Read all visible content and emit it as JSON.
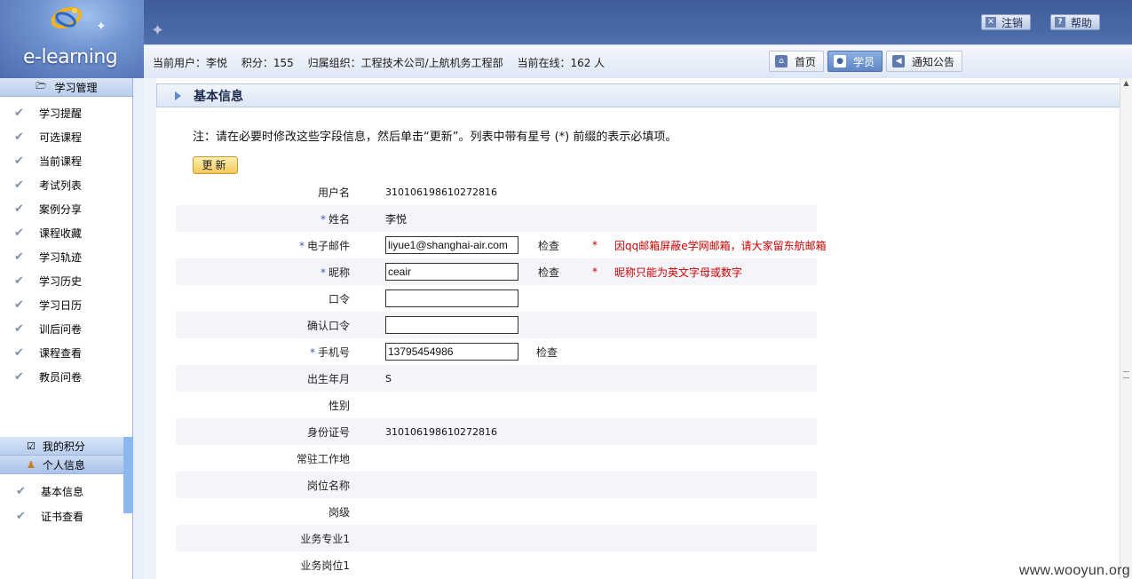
{
  "app": {
    "logo_text": "e-learning"
  },
  "top_links": [
    {
      "icon": "close-icon",
      "label": "注销"
    },
    {
      "icon": "help-icon",
      "label": "帮助"
    }
  ],
  "info_bar": {
    "user": "当前用户：李悦",
    "points": "积分：155",
    "org": "归属组织：工程技术公司/上航机务工程部",
    "online": "当前在线：162 人"
  },
  "nav": [
    {
      "icon": "home-icon",
      "label": "首页",
      "active": false
    },
    {
      "icon": "user-icon",
      "label": "学员",
      "active": true
    },
    {
      "icon": "speaker-icon",
      "label": "通知公告",
      "active": false
    }
  ],
  "sidebar": {
    "section1": "学习管理",
    "items": [
      {
        "label": "学习提醒"
      },
      {
        "label": "可选课程"
      },
      {
        "label": "当前课程"
      },
      {
        "label": "考试列表"
      },
      {
        "label": "案例分享"
      },
      {
        "label": "课程收藏"
      },
      {
        "label": "学习轨迹"
      },
      {
        "label": "学习历史"
      },
      {
        "label": "学习日历"
      },
      {
        "label": "训后问卷"
      },
      {
        "label": "课程查看"
      },
      {
        "label": "教员问卷"
      }
    ],
    "section2": "我的积分",
    "section3": "个人信息",
    "items2": [
      {
        "label": "基本信息"
      },
      {
        "label": "证书查看"
      }
    ]
  },
  "panel": {
    "title": "基本信息",
    "note": "注：请在必要时修改这些字段信息，然后单击“更新”。列表中带有星号 (*) 前缀的表示必填项。",
    "update_label": "更新"
  },
  "form": {
    "username": {
      "label": "用户名",
      "value": "310106198610272816"
    },
    "name": {
      "star": "*",
      "label": "姓名",
      "value": "李悦"
    },
    "email": {
      "star": "*",
      "label": "电子邮件",
      "value": "liyue1@shanghai-air.com",
      "check": "检查",
      "req": "*",
      "hint": "因qq邮箱屏蔽e学网邮箱，请大家留东航邮箱"
    },
    "nickname": {
      "star": "*",
      "label": "昵称",
      "value": "ceair",
      "check": "检查",
      "req": "*",
      "hint": "昵称只能为英文字母或数字"
    },
    "password": {
      "label": "口令",
      "value": ""
    },
    "confirm": {
      "label": "确认口令",
      "value": ""
    },
    "mobile": {
      "star": "*",
      "label": "手机号",
      "value": "13795454986",
      "check": "检查"
    },
    "birth": {
      "label": "出生年月",
      "value": "S"
    },
    "gender": {
      "label": "性别",
      "value": ""
    },
    "idcard": {
      "label": "身份证号",
      "value": "310106198610272816"
    },
    "workplace": {
      "label": "常驻工作地",
      "value": ""
    },
    "position": {
      "label": "岗位名称",
      "value": ""
    },
    "grade": {
      "label": "岗级",
      "value": ""
    },
    "specialty": {
      "label": "业务专业1",
      "value": ""
    },
    "post": {
      "label": "业务岗位1",
      "value": ""
    }
  },
  "watermark": "www.wooyun.org"
}
